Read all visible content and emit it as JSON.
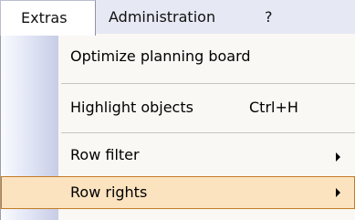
{
  "menubar": {
    "items": [
      {
        "label": "Extras"
      },
      {
        "label": "Administration"
      },
      {
        "label": "?"
      }
    ]
  },
  "dropdown": {
    "items": [
      {
        "label": "Optimize planning board",
        "shortcut": ""
      },
      {
        "label": "Highlight objects",
        "shortcut": "Ctrl+H"
      },
      {
        "label": "Row filter",
        "submenu_icon": "chevron-right-icon"
      },
      {
        "label": "Row rights",
        "submenu_icon": "chevron-right-icon",
        "highlighted": true
      }
    ]
  },
  "colors": {
    "menubar_bg": "#e6e8f4",
    "menu_bg": "#f9f8f4",
    "highlight_bg": "#fbe3c0",
    "highlight_border": "#c27c27"
  }
}
